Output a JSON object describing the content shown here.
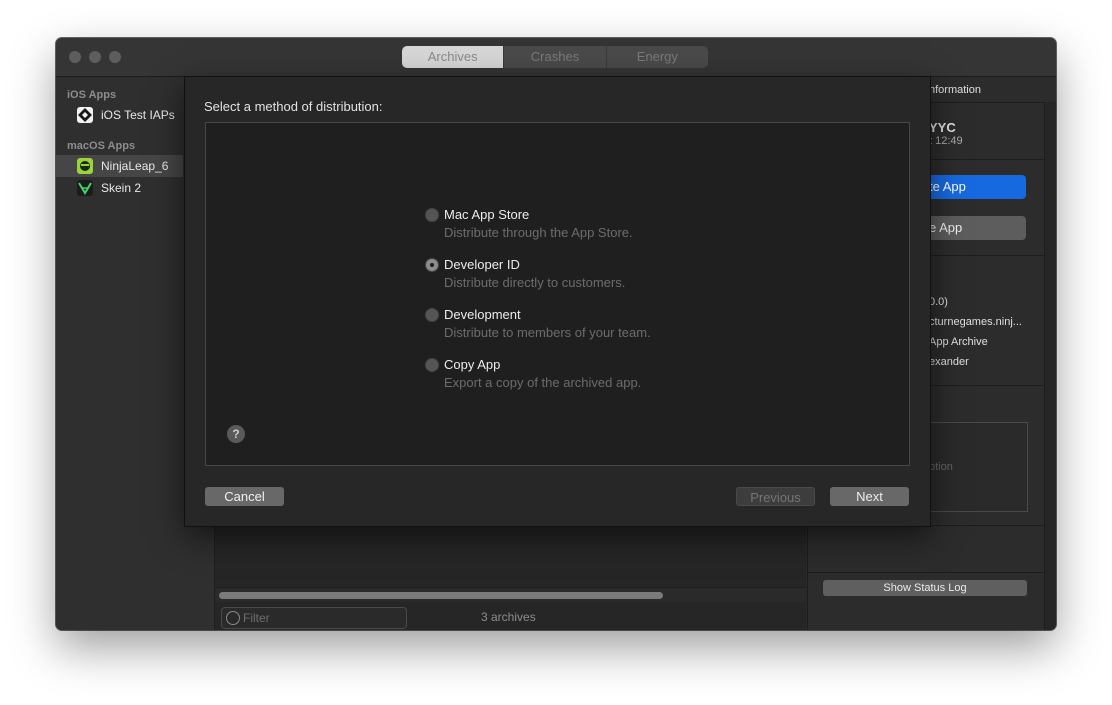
{
  "window": {
    "tabs": [
      "Archives",
      "Crashes",
      "Energy"
    ],
    "active_tab": "Archives"
  },
  "sidebar": {
    "sections": [
      {
        "header": "iOS Apps",
        "items": [
          {
            "label": "iOS Test IAPs",
            "icon": "app-icon-ios-test-iaps"
          }
        ]
      },
      {
        "header": "macOS Apps",
        "items": [
          {
            "label": "NinjaLeap_6",
            "icon": "app-icon-ninjaleap",
            "selected": true
          },
          {
            "label": "Skein 2",
            "icon": "app-icon-skein"
          }
        ]
      }
    ]
  },
  "main": {
    "filter_placeholder": "Filter",
    "archive_count": "3 archives"
  },
  "right_panel": {
    "header_fragment": "nformation",
    "archive_name_fragment": "YYC",
    "time_fragment": "t 12:49",
    "primary_button_fragment": "te App",
    "secondary_button_fragment": "e App",
    "detail_fragments": [
      "0.0)",
      "cturnegames.ninj...",
      "App Archive",
      "exander"
    ],
    "description_fragment": "ption",
    "status_log_button": "Show Status Log"
  },
  "sheet": {
    "title": "Select a method of distribution:",
    "options": [
      {
        "title": "Mac App Store",
        "desc": "Distribute through the App Store.",
        "selected": false
      },
      {
        "title": "Developer ID",
        "desc": "Distribute directly to customers.",
        "selected": true
      },
      {
        "title": "Development",
        "desc": "Distribute to members of your team.",
        "selected": false
      },
      {
        "title": "Copy App",
        "desc": "Export a copy of the archived app.",
        "selected": false
      }
    ],
    "help_label": "?",
    "cancel_label": "Cancel",
    "previous_label": "Previous",
    "next_label": "Next"
  },
  "colors": {
    "accent_blue": "#1769e0",
    "window_bg": "#2b2b2b"
  }
}
